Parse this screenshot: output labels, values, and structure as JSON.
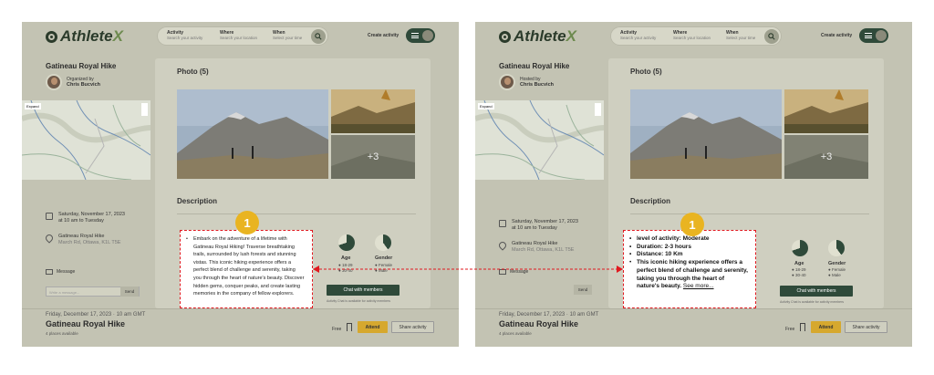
{
  "app": {
    "brand_prefix": "Athlete",
    "brand_suffix": "X",
    "search": {
      "activity_label": "Activity",
      "activity_placeholder": "Search your activity",
      "where_label": "Where",
      "where_placeholder": "Search your location",
      "when_label": "When",
      "when_placeholder": "Select your time"
    },
    "create_activity": "Create activity"
  },
  "before": {
    "activity_title": "Gatineau Royal Hike",
    "organizer_role": "Organized by",
    "organizer_name": "Chris Bucvich",
    "map_tag": "Expand",
    "date_line1": "Saturday, November 17, 2023",
    "date_line2": "at 10 am to Tuesday",
    "location_name": "Gatineau Royal Hike",
    "location_address": "March Rd, Ottawa, K1L T5E",
    "message_label": "Message",
    "message_placeholder": "Write a message...",
    "send": "Send",
    "photo_title": "Photo (5)",
    "photo_more": "+3",
    "description_title": "Description",
    "age_label": "Age",
    "age_legend_1": "18-29",
    "age_legend_2": "30-40",
    "gender_label": "Gender",
    "gender_legend_1": "Female",
    "gender_legend_2": "Male",
    "chat_button": "Chat with members",
    "chat_note": "Activity Chat is available for activity members",
    "footer_date": "Friday, December 17, 2023  ·  10 am GMT",
    "footer_title": "Gatineau Royal Hike",
    "footer_places": "4 places available",
    "free": "Free",
    "attend": "Attend",
    "share": "Share activity",
    "callout_text": "Embark on the adventure of a lifetime with Gatineau Royal Hiking! Traverse breathtaking trails, surrounded by lush forests and stunning vistas. This iconic hiking experience offers a perfect blend of challenge and serenity, taking you through the heart of nature's beauty. Discover hidden gems, conquer peaks, and create lasting memories in the company of fellow explorers."
  },
  "after": {
    "activity_title": "Gatineau Royal Hike",
    "organizer_role": "Hosted by",
    "organizer_name": "Chris Bucvich",
    "map_tag": "Expand",
    "date_line1": "Saturday, November 17, 2023",
    "date_line2": "at 10 am to Tuesday",
    "location_name": "Gatineau Royal Hike",
    "location_address": "March Rd, Ottawa, K1L T5E",
    "message_label": "Message",
    "send": "Send",
    "photo_title": "Photo (5)",
    "photo_more": "+3",
    "description_title": "Description",
    "age_label": "Age",
    "age_legend_1": "18-29",
    "age_legend_2": "30-40",
    "gender_label": "Gender",
    "gender_legend_1": "Female",
    "gender_legend_2": "Male",
    "chat_button": "Chat with members",
    "chat_note": "Activity Chat is available for activity members",
    "footer_date": "Friday, December 17, 2023  ·  10 am GMT",
    "footer_title": "Gatineau Royal Hike",
    "footer_places": "4 places available",
    "free": "Free",
    "attend": "Attend",
    "share": "Share activity",
    "callout_items": [
      "level of activity: Moderate",
      "Duration: 2-3 hours",
      "Distance: 10 Km",
      "This iconic hiking experience offers a perfect blend of challenge and serenity, taking you through the heart of nature's beauty."
    ],
    "see_more": "See more..."
  },
  "annotation": {
    "badge_number": "1",
    "accent_color": "#e0191f",
    "badge_color": "#e9b421"
  }
}
